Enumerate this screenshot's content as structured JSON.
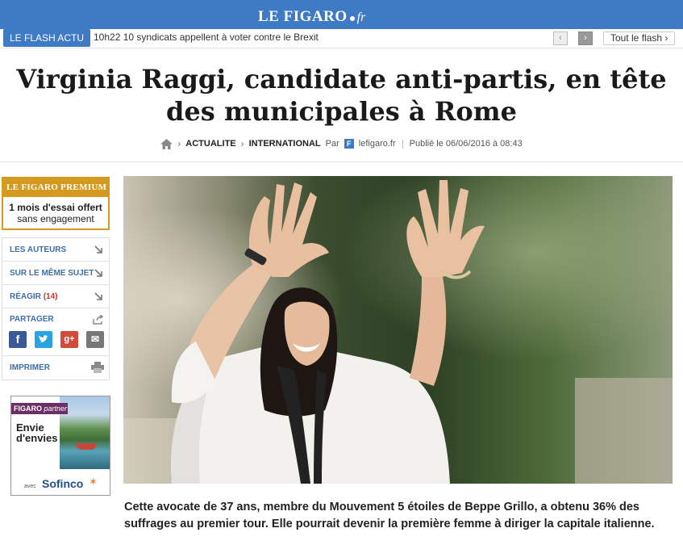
{
  "header": {
    "logo_main": "LE FIGARO",
    "logo_suffix": "fr"
  },
  "flash": {
    "badge": "LE FLASH ACTU",
    "time": "10h22",
    "headline": "10 syndicats appellent à voter contre le Brexit",
    "prev": "‹",
    "next": "›",
    "all_label": "Tout le flash",
    "all_arrow": "›"
  },
  "article": {
    "title_line1": "Virginia Raggi, candidate anti-partis, en tête",
    "title_line2": "des municipales à Rome",
    "breadcrumb": [
      "ACTUALITE",
      "INTERNATIONAL"
    ],
    "by_label": "Par",
    "source_badge": "F",
    "source": "lefigaro.fr",
    "published": "Publié le 06/06/2016 à 08:43",
    "lead": "Cette avocate de 37 ans, membre du Mouvement 5 étoiles de Beppe Grillo, a obtenu 36% des suffrages au premier tour. Elle pourrait devenir la première femme à diriger la capitale italienne."
  },
  "premium": {
    "head": "LE FIGARO PREMIUM",
    "offer": "1 mois d'essai offert",
    "sub": "sans engagement"
  },
  "sidebar": {
    "authors": "LES AUTEURS",
    "same_subject": "SUR LE MÊME SUJET",
    "react": "RÉAGIR",
    "react_count": "(14)",
    "share": "PARTAGER",
    "print": "IMPRIMER",
    "share_icons": [
      "facebook-icon",
      "twitter-icon",
      "google-plus-icon",
      "mail-icon"
    ],
    "fb_glyph": "f",
    "gp_glyph": "g+",
    "mail_glyph": "✉"
  },
  "ad": {
    "head_brand": "FIGARO",
    "head_partner": "partner",
    "line1": "Envie",
    "line2": "d'envies",
    "avec": "avec",
    "brand": "Sofinco",
    "star": "✶"
  },
  "colors": {
    "brand_blue": "#3f7ac5",
    "premium_gold": "#d39a1f",
    "link_blue": "#3f6fa5"
  }
}
